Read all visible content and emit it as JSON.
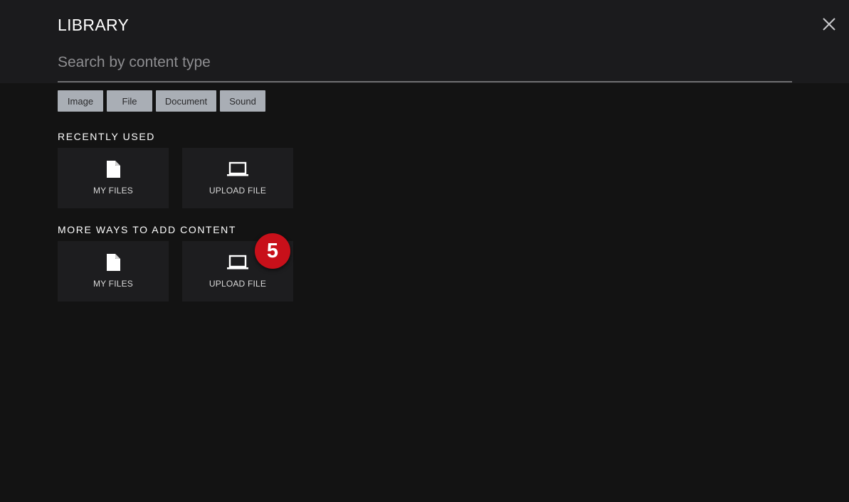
{
  "dialog": {
    "title": "LIBRARY"
  },
  "search": {
    "placeholder": "Search by content type",
    "value": ""
  },
  "filters": [
    {
      "label": "Image"
    },
    {
      "label": "File"
    },
    {
      "label": "Document"
    },
    {
      "label": "Sound"
    }
  ],
  "sections": {
    "recent": {
      "title": "RECENTLY USED",
      "items": [
        {
          "label": "MY FILES",
          "icon": "file-icon"
        },
        {
          "label": "UPLOAD FILE",
          "icon": "laptop-icon"
        }
      ]
    },
    "more": {
      "title": "MORE WAYS TO ADD CONTENT",
      "items": [
        {
          "label": "MY FILES",
          "icon": "file-icon"
        },
        {
          "label": "UPLOAD FILE",
          "icon": "laptop-icon"
        }
      ]
    }
  },
  "step_badge": {
    "number": "5",
    "color": "#c8101a"
  },
  "colors": {
    "background": "#131313",
    "header": "#1b1b1d",
    "tile": "#1d1d1f",
    "chip": "#a9aeb5"
  }
}
